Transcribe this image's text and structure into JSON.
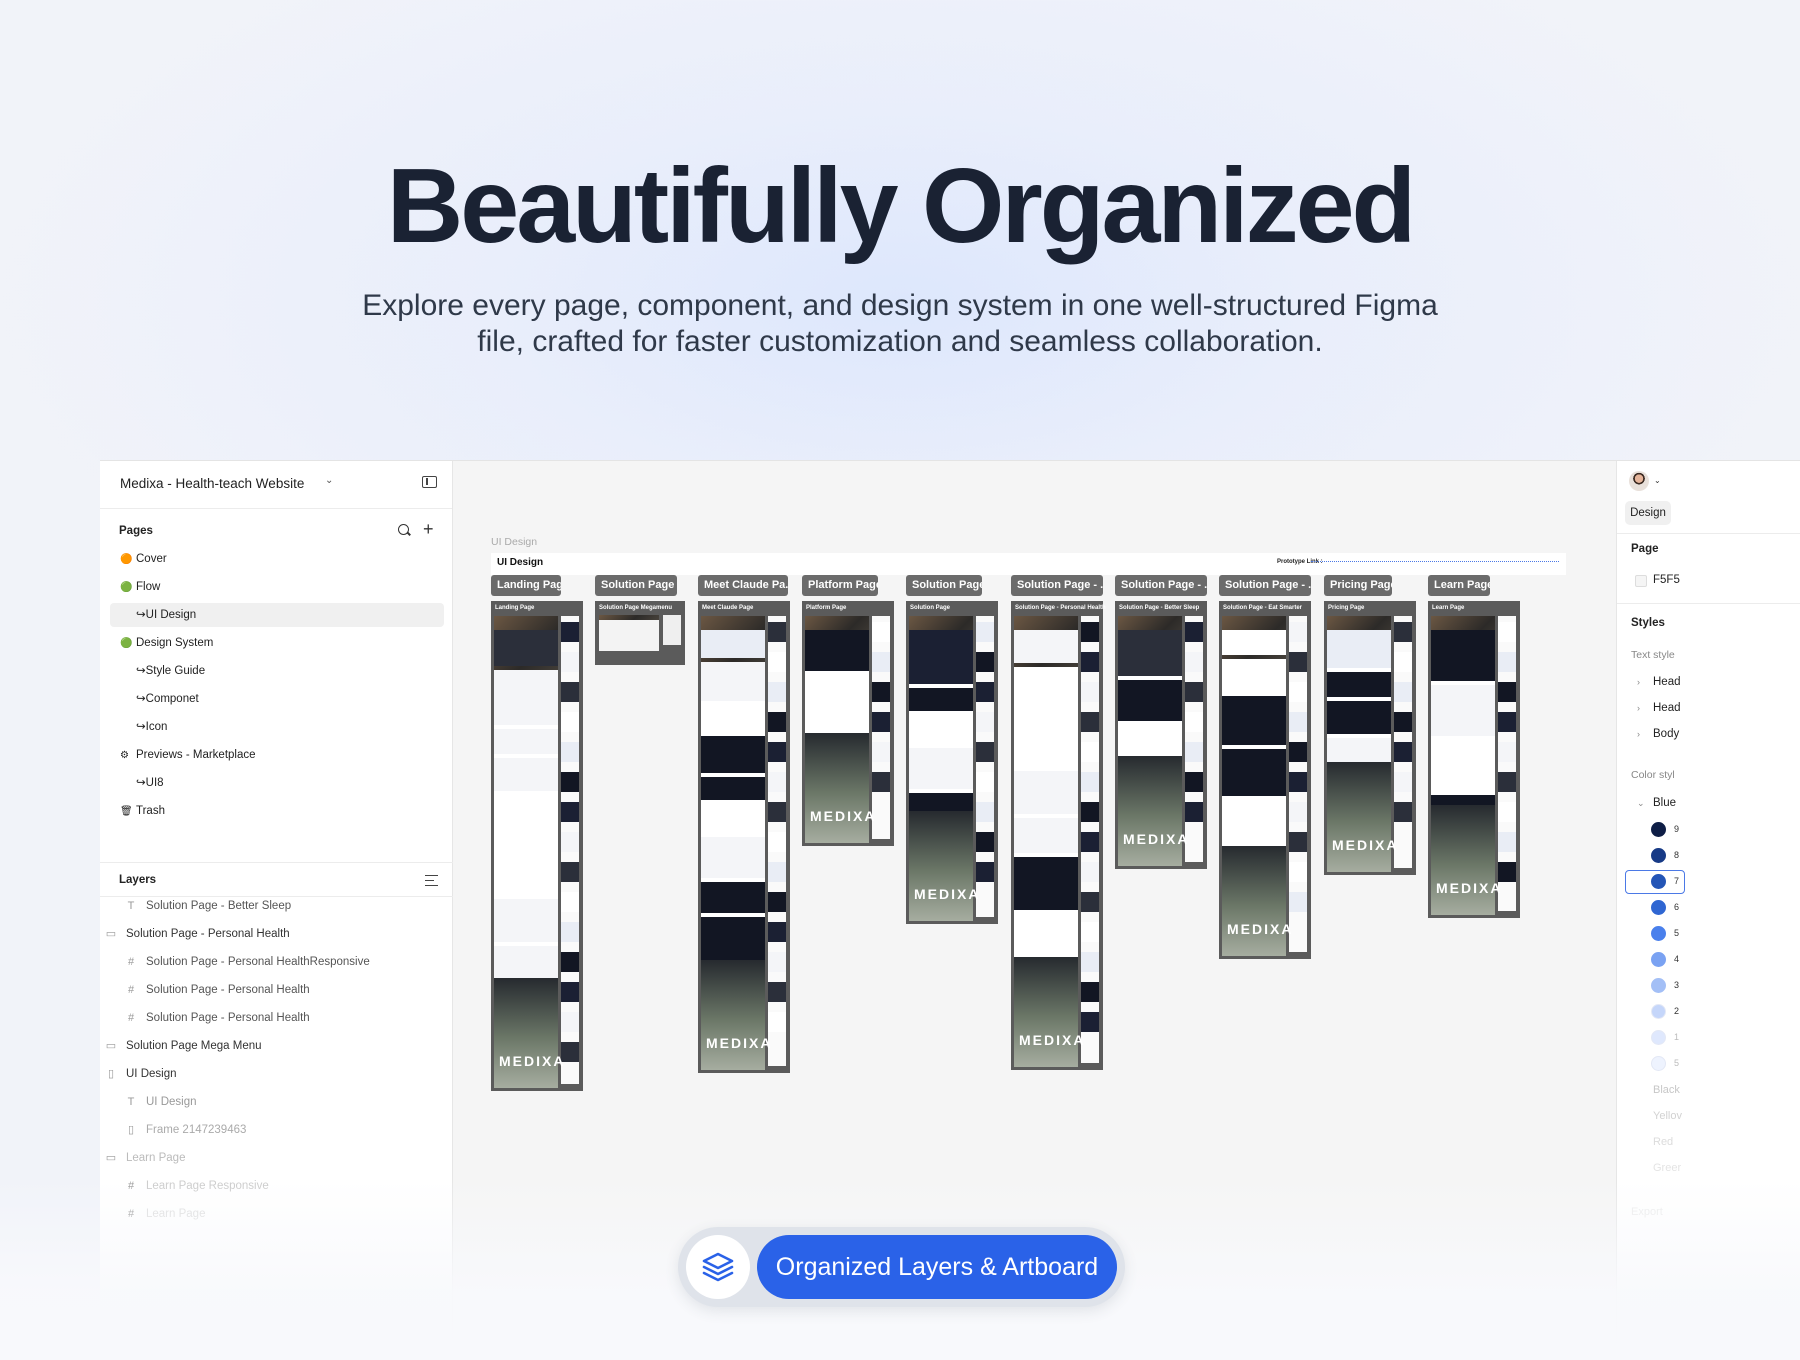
{
  "hero": {
    "title": "Beautifully Organized",
    "subtitle": "Explore every page, component, and design system in one well-structured Figma file, crafted for faster customization and seamless collaboration."
  },
  "file": {
    "name": "Medixa - Health-teach Website"
  },
  "pages": {
    "label": "Pages",
    "items": [
      {
        "label": "Cover",
        "emoji": "🟠"
      },
      {
        "label": "Flow",
        "emoji": "🟢"
      },
      {
        "label": "↪UI Design",
        "selected": true
      },
      {
        "label": "Design System",
        "emoji": "🟢"
      },
      {
        "label": "↪Style Guide"
      },
      {
        "label": "↪Componet"
      },
      {
        "label": "↪Icon"
      },
      {
        "label": "Previews - Marketplace",
        "emoji": "⚙"
      },
      {
        "label": "↪UI8"
      },
      {
        "label": "Trash",
        "emoji": "🗑"
      }
    ]
  },
  "layers": {
    "label": "Layers",
    "items": [
      {
        "label": "Solution Page - Better Sleep",
        "icon": "T"
      },
      {
        "label": "Solution Page - Personal Health",
        "icon": "▭"
      },
      {
        "label": "Solution Page - Personal HealthResponsive",
        "icon": "#"
      },
      {
        "label": "Solution Page - Personal Health",
        "icon": "#"
      },
      {
        "label": "Solution Page - Personal Health",
        "icon": "#"
      },
      {
        "label": "Solution Page Mega Menu",
        "icon": "▭"
      },
      {
        "label": "UI Design",
        "icon": "▯"
      },
      {
        "label": "UI Design",
        "icon": "T"
      },
      {
        "label": "Frame 2147239463",
        "icon": "▯"
      },
      {
        "label": "Learn Page",
        "icon": "▭"
      },
      {
        "label": "Learn Page Responsive",
        "icon": "#"
      },
      {
        "label": "Learn Page",
        "icon": "#"
      }
    ]
  },
  "canvas": {
    "section_label": "UI Design",
    "section_title": "UI Design",
    "prototype_label": "Prototype Link :",
    "frames": [
      {
        "tag": "Landing Page",
        "title": "Landing Page",
        "brand": "MEDIXA"
      },
      {
        "tag": "Solution Page ...",
        "title": "Solution Page Megamenu",
        "brand": ""
      },
      {
        "tag": "Meet Claude Pa...",
        "title": "Meet Claude Page",
        "brand": "MEDIXA"
      },
      {
        "tag": "Platform Page",
        "title": "Platform Page",
        "brand": "MEDIXA"
      },
      {
        "tag": "Solution Page",
        "title": "Solution Page",
        "brand": "MEDIXA"
      },
      {
        "tag": "Solution Page - ...",
        "title": "Solution Page - Personal Health",
        "brand": "MEDIXA"
      },
      {
        "tag": "Solution Page - ...",
        "title": "Solution Page - Better Sleep",
        "brand": "MEDIXA"
      },
      {
        "tag": "Solution Page - ...",
        "title": "Solution Page - Eat Smarter",
        "brand": "MEDIXA"
      },
      {
        "tag": "Pricing Page",
        "title": "Pricing Page",
        "brand": "MEDIXA"
      },
      {
        "tag": "Learn Page",
        "title": "Learn Page",
        "brand": "MEDIXA"
      }
    ]
  },
  "right_panel": {
    "tab": "Design",
    "page_label": "Page",
    "page_color": "F5F5",
    "styles_label": "Styles",
    "text_styles_label": "Text style",
    "text_styles": [
      "Head",
      "Head",
      "Body"
    ],
    "color_styles_label": "Color styl",
    "group_blue": "Blue",
    "blue_swatches": [
      {
        "color": "#0e1e46",
        "num": "9"
      },
      {
        "color": "#173a86",
        "num": "8"
      },
      {
        "color": "#2455b6",
        "num": "7"
      },
      {
        "color": "#2f66d2",
        "num": "6"
      },
      {
        "color": "#4a80ec",
        "num": "5"
      },
      {
        "color": "#7aa2f2",
        "num": "4"
      },
      {
        "color": "#a3bff6",
        "num": "3"
      },
      {
        "color": "#c5d6fa",
        "num": "2"
      },
      {
        "color": "#dfe8fd",
        "num": "1"
      },
      {
        "color": "#eef3fe",
        "num": "5"
      }
    ],
    "other_groups": [
      "Black",
      "Yellov",
      "Red",
      "Greer"
    ],
    "export_label": "Export"
  },
  "badge": {
    "label": "Organized Layers & Artboard"
  }
}
